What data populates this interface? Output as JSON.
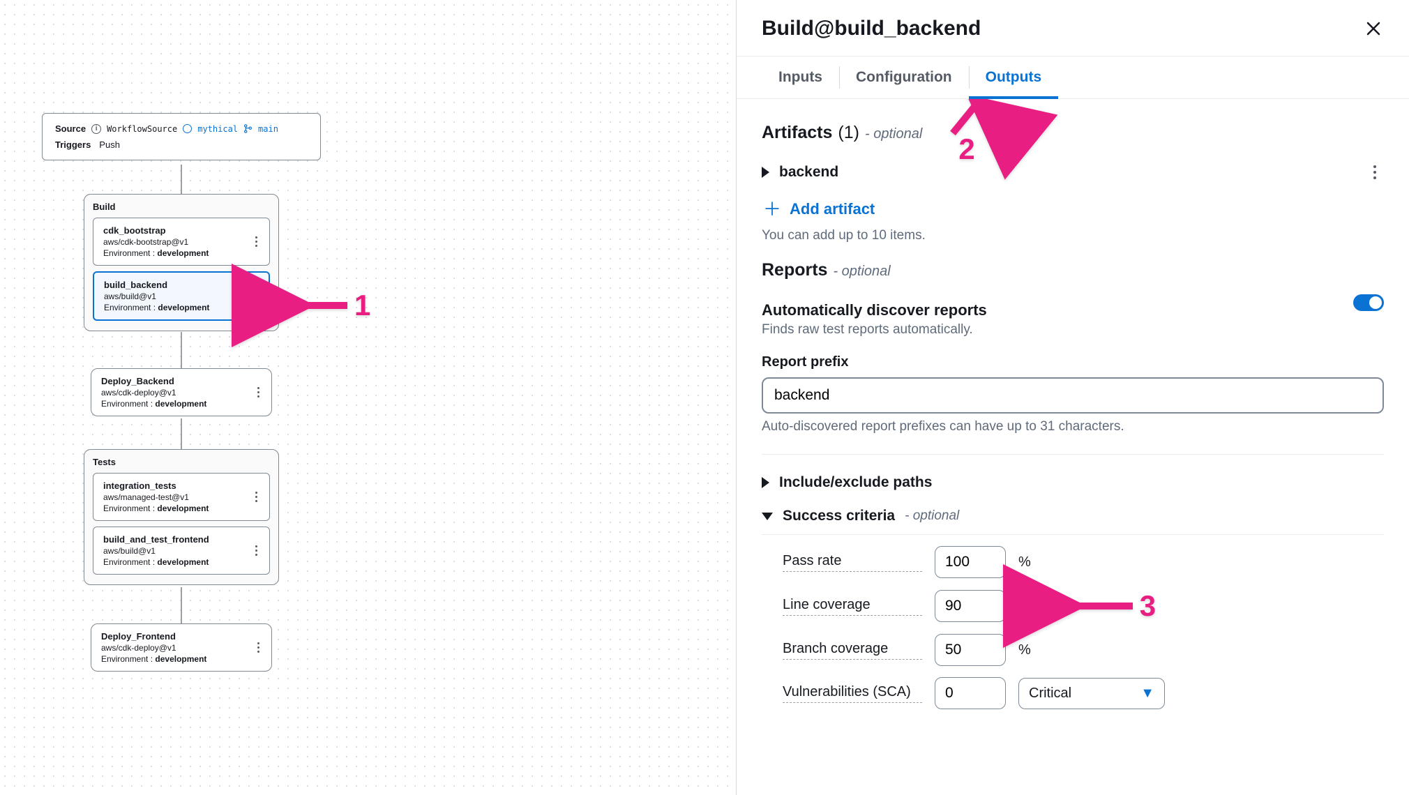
{
  "annotations": {
    "a1": "1",
    "a2": "2",
    "a3": "3"
  },
  "workflow": {
    "source": {
      "label": "Source",
      "nameMono": "WorkflowSource",
      "repo": "mythical",
      "branch": "main",
      "triggersLabel": "Triggers",
      "triggersValue": "Push"
    },
    "groups": [
      {
        "title": "Build",
        "items": [
          {
            "title": "cdk_bootstrap",
            "sub": "aws/cdk-bootstrap@v1",
            "envKey": "Environment :",
            "envVal": "development",
            "selected": false
          },
          {
            "title": "build_backend",
            "sub": "aws/build@v1",
            "envKey": "Environment :",
            "envVal": "development",
            "selected": true
          }
        ]
      },
      {
        "title": "",
        "items": [
          {
            "title": "Deploy_Backend",
            "sub": "aws/cdk-deploy@v1",
            "envKey": "Environment :",
            "envVal": "development",
            "selected": false
          }
        ]
      },
      {
        "title": "Tests",
        "items": [
          {
            "title": "integration_tests",
            "sub": "aws/managed-test@v1",
            "envKey": "Environment :",
            "envVal": "development",
            "selected": false
          },
          {
            "title": "build_and_test_frontend",
            "sub": "aws/build@v1",
            "envKey": "Environment :",
            "envVal": "development",
            "selected": false
          }
        ]
      },
      {
        "title": "",
        "items": [
          {
            "title": "Deploy_Frontend",
            "sub": "aws/cdk-deploy@v1",
            "envKey": "Environment :",
            "envVal": "development",
            "selected": false
          }
        ]
      }
    ]
  },
  "panel": {
    "title": "Build@build_backend",
    "tabs": {
      "inputs": "Inputs",
      "configuration": "Configuration",
      "outputs": "Outputs"
    },
    "artifacts": {
      "heading": "Artifacts",
      "count": "(1)",
      "optional": "- optional",
      "item": "backend",
      "add": "Add artifact",
      "helper": "You can add up to 10 items."
    },
    "reports": {
      "heading": "Reports",
      "optional": "- optional",
      "autoTitle": "Automatically discover reports",
      "autoHelp": "Finds raw test reports automatically.",
      "prefixLabel": "Report prefix",
      "prefixValue": "backend",
      "prefixHelp": "Auto-discovered report prefixes can have up to 31 characters.",
      "includeExclude": "Include/exclude paths",
      "successCriteria": "Success criteria",
      "scOptional": "- optional",
      "criteria": {
        "passRate": {
          "label": "Pass rate",
          "value": "100",
          "unit": "%"
        },
        "lineCoverage": {
          "label": "Line coverage",
          "value": "90",
          "unit": "%"
        },
        "branchCoverage": {
          "label": "Branch coverage",
          "value": "50",
          "unit": "%"
        },
        "vuln": {
          "label": "Vulnerabilities (SCA)",
          "value": "0",
          "select": "Critical"
        }
      }
    }
  }
}
